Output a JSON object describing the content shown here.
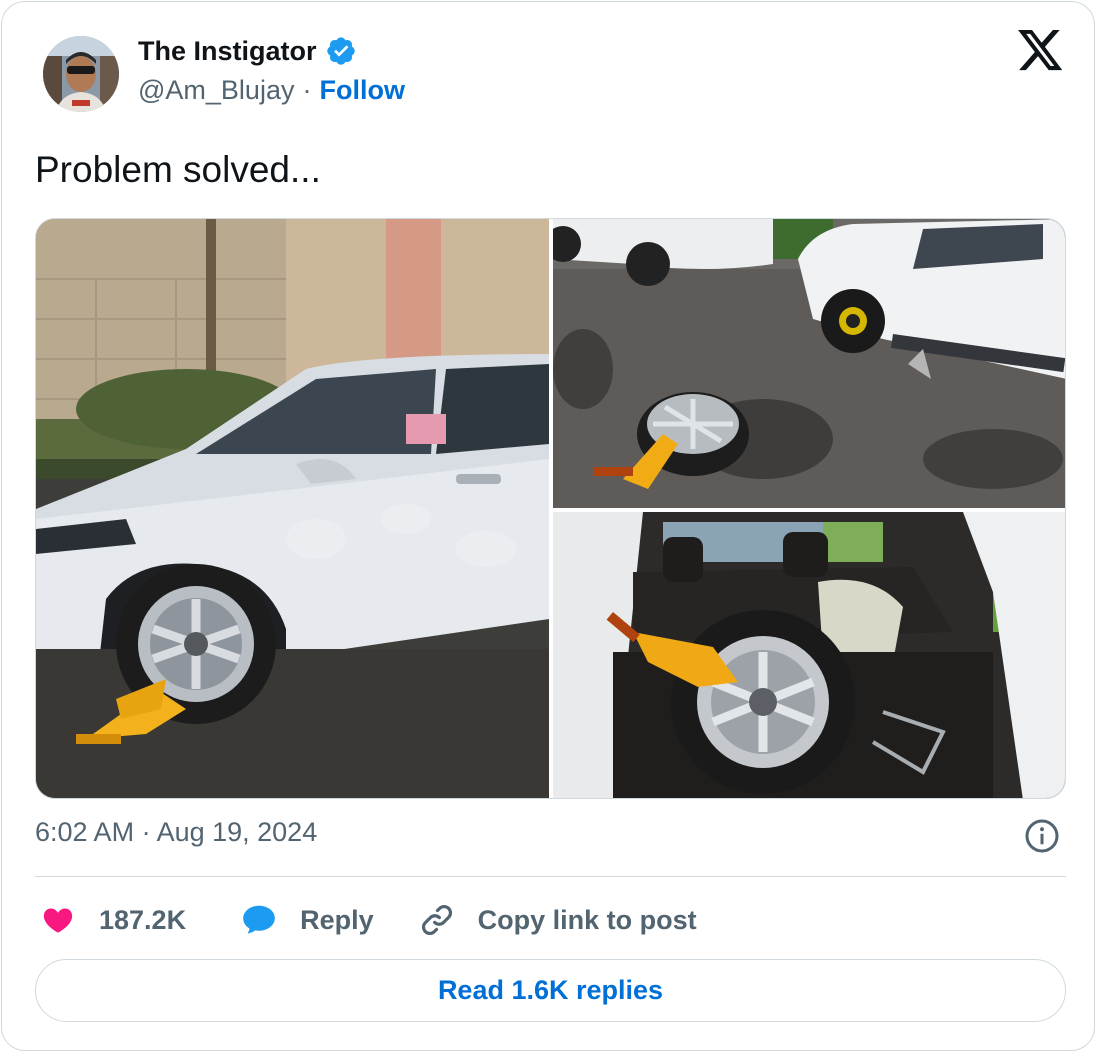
{
  "author": {
    "name": "The Instigator",
    "handle": "@Am_Blujay",
    "separator": "·",
    "follow_label": "Follow",
    "verified": true
  },
  "tweet": {
    "text": "Problem solved...",
    "timestamp": "6:02 AM · Aug 19, 2024",
    "media_count": 3
  },
  "actions": {
    "like_count": "187.2K",
    "reply_label": "Reply",
    "copy_link_label": "Copy link to post"
  },
  "read_replies_label": "Read 1.6K replies",
  "icons": {
    "brand": "x-logo-icon",
    "verified": "verified-badge-icon",
    "info": "info-icon",
    "like": "heart-icon",
    "reply": "speech-bubble-icon",
    "link": "link-icon"
  },
  "colors": {
    "link_blue": "#006fd6",
    "verified_blue": "#1d9bf0",
    "heart_pink": "#f91880",
    "secondary_text": "#536471",
    "border": "#cfd9de"
  }
}
